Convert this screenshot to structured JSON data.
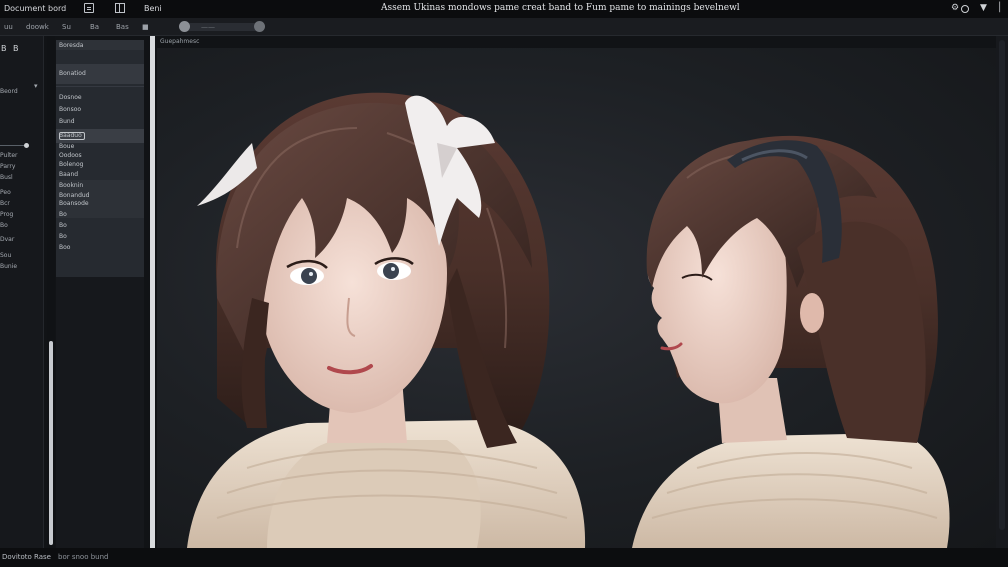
{
  "window": {
    "app_name": "Document bord",
    "menu_label": "Beni",
    "title": "Assem Ukinas mondows pame creat band to Fum pame to mainings bevelnewl"
  },
  "toolbar": {
    "tool1": "uu",
    "tool2": "doowk",
    "tool3": "Su",
    "tool4": "Ba",
    "tool5": "Bas",
    "zoom_label": "——"
  },
  "rail": {
    "top1": "B",
    "top2": "B",
    "items": [
      "Beord",
      "Pulter",
      "Parry",
      "Busl",
      "Peo",
      "Bcr",
      "Prog",
      "Bo",
      "Dvar",
      "Sou",
      "Bunie"
    ]
  },
  "panel": {
    "header": "Boresda",
    "selected": "Bonatiod",
    "items": [
      "Dosnoe",
      "Bonsoo",
      "Bund",
      "Baaduo",
      "Boue",
      "Oodoos",
      "Bolenog",
      "Baand",
      "Booknin",
      "Bonandud",
      "Boansode",
      "Bo",
      "Bo",
      "Bo",
      "Boo"
    ]
  },
  "canvas": {
    "label": "Guepahmesc"
  },
  "status": {
    "left": "Dovitoto Rase",
    "right": "bor snoo bund"
  },
  "colors": {
    "hair": "#4a3029",
    "hair_highlight": "#8a6a60",
    "skin": "#efd6cc",
    "sweater": "#e8d9c8",
    "ribbon": "#f1eeee",
    "headband": "#2a2f38"
  }
}
